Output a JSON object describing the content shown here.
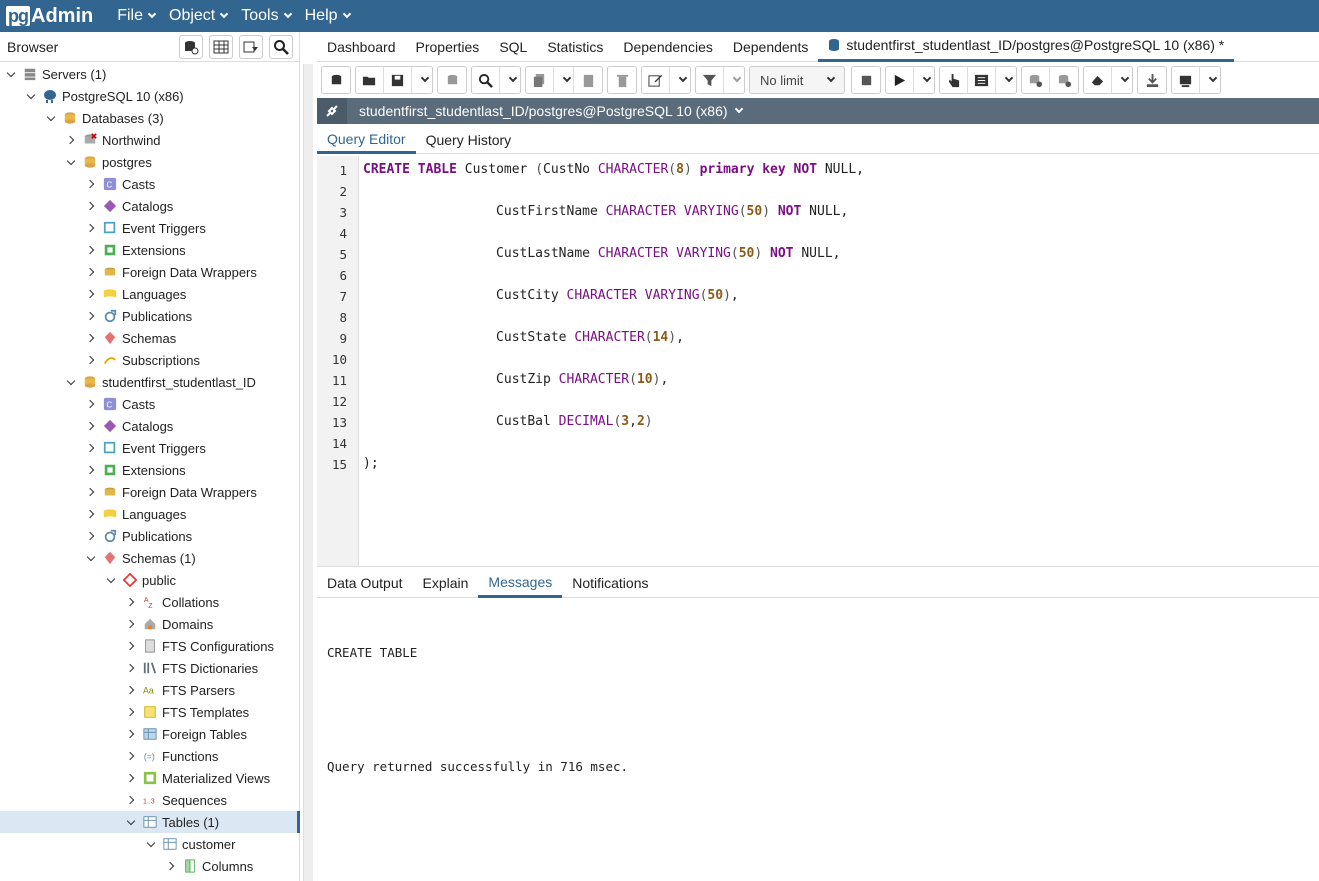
{
  "app": {
    "logo_pg": "pg",
    "logo_admin": "Admin"
  },
  "menu": [
    "File",
    "Object",
    "Tools",
    "Help"
  ],
  "browser": {
    "title": "Browser",
    "tree": [
      {
        "label": "Servers (1)",
        "level": 0,
        "state": "open",
        "icon": "servers-icon"
      },
      {
        "label": "PostgreSQL 10 (x86)",
        "level": 1,
        "state": "open",
        "icon": "postgres-elephant-icon"
      },
      {
        "label": "Databases (3)",
        "level": 2,
        "state": "open",
        "icon": "databases-icon"
      },
      {
        "label": "Northwind",
        "level": 3,
        "state": "closed",
        "icon": "database-disconnected-icon"
      },
      {
        "label": "postgres",
        "level": 3,
        "state": "open",
        "icon": "database-icon"
      },
      {
        "label": "Casts",
        "level": 4,
        "state": "closed",
        "icon": "casts-icon"
      },
      {
        "label": "Catalogs",
        "level": 4,
        "state": "closed",
        "icon": "catalogs-icon"
      },
      {
        "label": "Event Triggers",
        "level": 4,
        "state": "closed",
        "icon": "event-triggers-icon"
      },
      {
        "label": "Extensions",
        "level": 4,
        "state": "closed",
        "icon": "extensions-icon"
      },
      {
        "label": "Foreign Data Wrappers",
        "level": 4,
        "state": "closed",
        "icon": "foreign-data-wrappers-icon"
      },
      {
        "label": "Languages",
        "level": 4,
        "state": "closed",
        "icon": "languages-icon"
      },
      {
        "label": "Publications",
        "level": 4,
        "state": "closed",
        "icon": "publications-icon"
      },
      {
        "label": "Schemas",
        "level": 4,
        "state": "closed",
        "icon": "schemas-icon"
      },
      {
        "label": "Subscriptions",
        "level": 4,
        "state": "closed",
        "icon": "subscriptions-icon"
      },
      {
        "label": "studentfirst_studentlast_ID",
        "level": 3,
        "state": "open",
        "icon": "database-icon"
      },
      {
        "label": "Casts",
        "level": 4,
        "state": "closed",
        "icon": "casts-icon"
      },
      {
        "label": "Catalogs",
        "level": 4,
        "state": "closed",
        "icon": "catalogs-icon"
      },
      {
        "label": "Event Triggers",
        "level": 4,
        "state": "closed",
        "icon": "event-triggers-icon"
      },
      {
        "label": "Extensions",
        "level": 4,
        "state": "closed",
        "icon": "extensions-icon"
      },
      {
        "label": "Foreign Data Wrappers",
        "level": 4,
        "state": "closed",
        "icon": "foreign-data-wrappers-icon"
      },
      {
        "label": "Languages",
        "level": 4,
        "state": "closed",
        "icon": "languages-icon"
      },
      {
        "label": "Publications",
        "level": 4,
        "state": "closed",
        "icon": "publications-icon"
      },
      {
        "label": "Schemas (1)",
        "level": 4,
        "state": "open",
        "icon": "schemas-icon"
      },
      {
        "label": "public",
        "level": 5,
        "state": "open",
        "icon": "schema-public-icon"
      },
      {
        "label": "Collations",
        "level": 6,
        "state": "closed",
        "icon": "collations-icon"
      },
      {
        "label": "Domains",
        "level": 6,
        "state": "closed",
        "icon": "domains-icon"
      },
      {
        "label": "FTS Configurations",
        "level": 6,
        "state": "closed",
        "icon": "fts-configurations-icon"
      },
      {
        "label": "FTS Dictionaries",
        "level": 6,
        "state": "closed",
        "icon": "fts-dictionaries-icon"
      },
      {
        "label": "FTS Parsers",
        "level": 6,
        "state": "closed",
        "icon": "fts-parsers-icon"
      },
      {
        "label": "FTS Templates",
        "level": 6,
        "state": "closed",
        "icon": "fts-templates-icon"
      },
      {
        "label": "Foreign Tables",
        "level": 6,
        "state": "closed",
        "icon": "foreign-tables-icon"
      },
      {
        "label": "Functions",
        "level": 6,
        "state": "closed",
        "icon": "functions-icon"
      },
      {
        "label": "Materialized Views",
        "level": 6,
        "state": "closed",
        "icon": "materialized-views-icon"
      },
      {
        "label": "Sequences",
        "level": 6,
        "state": "closed",
        "icon": "sequences-icon"
      },
      {
        "label": "Tables (1)",
        "level": 6,
        "state": "open",
        "icon": "tables-icon",
        "selected": true
      },
      {
        "label": "customer",
        "level": 7,
        "state": "open",
        "icon": "table-icon"
      },
      {
        "label": "Columns",
        "level": 8,
        "state": "closed",
        "icon": "columns-icon"
      }
    ]
  },
  "tabs": [
    "Dashboard",
    "Properties",
    "SQL",
    "Statistics",
    "Dependencies",
    "Dependents"
  ],
  "active_tab": "studentfirst_studentlast_ID/postgres@PostgreSQL 10 (x86) *",
  "toolbar": {
    "limit": "No limit"
  },
  "connection": "studentfirst_studentlast_ID/postgres@PostgreSQL 10 (x86)",
  "subtabs": [
    "Query Editor",
    "Query History"
  ],
  "line_numbers": [
    "1",
    "2",
    "3",
    "4",
    "5",
    "6",
    "7",
    "8",
    "9",
    "10",
    "11",
    "12",
    "13",
    "14",
    "15"
  ],
  "output_tabs": [
    "Data Output",
    "Explain",
    "Messages",
    "Notifications"
  ],
  "messages": {
    "line1": "CREATE TABLE",
    "line2": "Query returned successfully in 716 msec."
  },
  "colors": {
    "header": "#326690",
    "connbar": "#5a6b7b",
    "keyword": "#7a0f85",
    "number": "#8c5a16"
  }
}
